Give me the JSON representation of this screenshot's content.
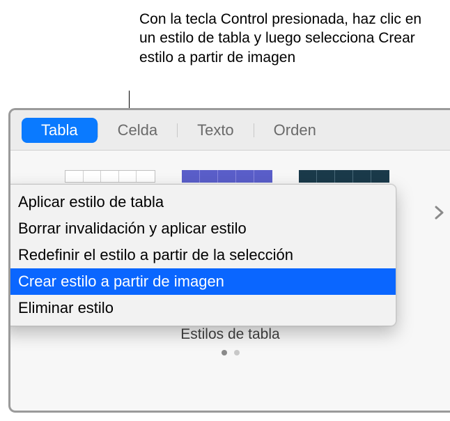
{
  "callout": {
    "text": "Con la tecla Control presionada, haz clic en un estilo de tabla y luego selecciona Crear estilo a partir de imagen"
  },
  "tabs": {
    "items": [
      {
        "label": "Tabla",
        "active": true
      },
      {
        "label": "Celda",
        "active": false
      },
      {
        "label": "Texto",
        "active": false
      },
      {
        "label": "Orden",
        "active": false
      }
    ]
  },
  "context_menu": {
    "items": [
      {
        "label": "Aplicar estilo de tabla",
        "highlighted": false
      },
      {
        "label": "Borrar invalidación y aplicar estilo",
        "highlighted": false
      },
      {
        "label": "Redefinir el estilo a partir de la selección",
        "highlighted": false
      },
      {
        "label": "Crear estilo a partir de imagen",
        "highlighted": true
      },
      {
        "label": "Eliminar estilo",
        "highlighted": false
      }
    ]
  },
  "styles_section": {
    "label": "Estilos de tabla"
  },
  "colors": {
    "accent": "#0a7aff",
    "menu_highlight": "#0a66ff"
  }
}
